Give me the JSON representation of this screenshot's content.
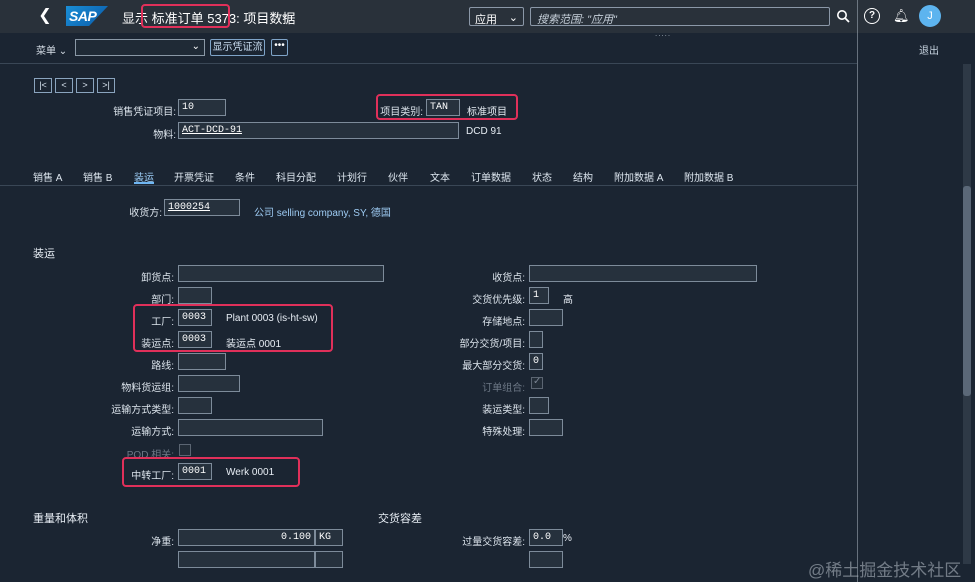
{
  "shell": {
    "logo": "SAP",
    "title": "显示 标准订单 5373: 项目数据",
    "scope": "应用",
    "search_placeholder": "搜索范围: \"应用\"",
    "avatar": "J",
    "grip": "....."
  },
  "toolbar": {
    "menu": "菜单",
    "flow_button": "显示凭证流",
    "more_button": "•••",
    "exit": "退出"
  },
  "nav": [
    "|<",
    "<",
    ">",
    ">|"
  ],
  "header": {
    "item_label": "销售凭证项目:",
    "item_value": "10",
    "material_label": "物料:",
    "material_value": "ACT-DCD-91",
    "material_desc": "DCD 91",
    "category_label": "项目类别:",
    "category_value": "TAN",
    "category_desc": "标准项目"
  },
  "tabs": [
    "销售 A",
    "销售 B",
    "装运",
    "开票凭证",
    "条件",
    "科目分配",
    "计划行",
    "伙伴",
    "文本",
    "订单数据",
    "状态",
    "结构",
    "附加数据 A",
    "附加数据 B"
  ],
  "ship_to": {
    "label": "收货方:",
    "value": "1000254",
    "desc": "公司 selling company, SY, 德国"
  },
  "shipping": {
    "section": "装运",
    "unloading_label": "卸货点:",
    "department_label": "部门:",
    "plant_label": "工厂:",
    "plant_value": "0003",
    "plant_desc": "Plant 0003 (is-ht-sw)",
    "shipping_point_label": "装运点:",
    "shipping_point_value": "0003",
    "shipping_point_desc": "装运点 0001",
    "route_label": "路线:",
    "material_freight_label": "物料货运组:",
    "transport_type_label": "运输方式类型:",
    "transport_label": "运输方式:",
    "pod_label": "POD 相关:",
    "transit_plant_label": "中转工厂:",
    "transit_plant_value": "0001",
    "transit_plant_desc": "Werk 0001",
    "receiving_point_label": "收货点:",
    "priority_label": "交货优先级:",
    "priority_value": "1",
    "priority_desc": "高",
    "storage_label": "存储地点:",
    "partial_label": "部分交货/项目:",
    "max_partial_label": "最大部分交货:",
    "max_partial_value": "0",
    "order_combo_label": "订单组合:",
    "shipping_type_label": "装运类型:",
    "special_label": "特殊处理:"
  },
  "weight": {
    "section": "重量和体积",
    "net_label": "净重:",
    "net_value": "0.100",
    "net_unit": "KG"
  },
  "tolerance": {
    "section": "交货容差",
    "over_label": "过量交货容差:",
    "over_value": "0.0",
    "over_unit": "%"
  },
  "watermark": "@稀土掘金技术社区",
  "colors": {
    "highlight": "#e0305a",
    "accent": "#9fd0fa",
    "background": "#1b2532"
  }
}
